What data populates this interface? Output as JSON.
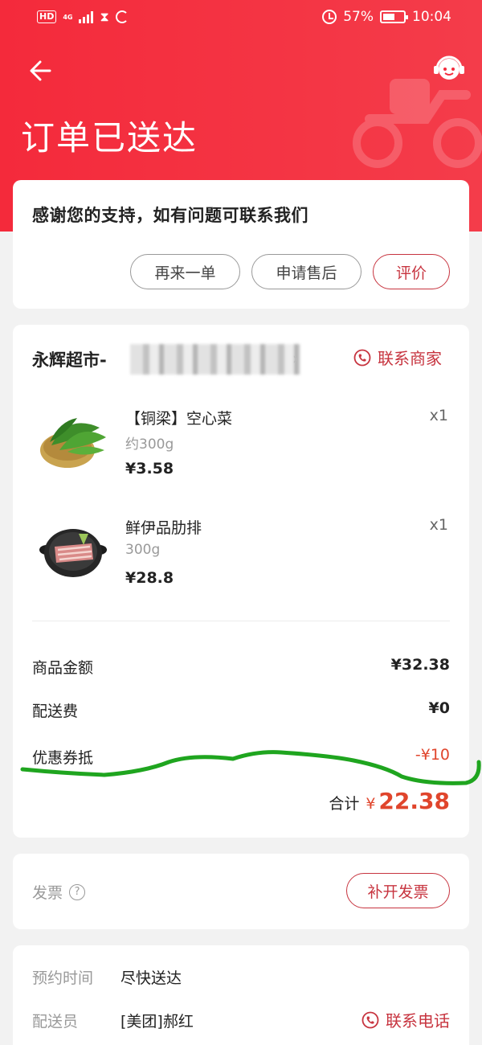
{
  "status_bar": {
    "hd": "HD",
    "network": "4G",
    "battery_percent": "57%",
    "time": "10:04"
  },
  "header": {
    "title": "订单已送达",
    "back_icon": "back-arrow-icon",
    "service_icon": "customer-service-icon"
  },
  "thanks_card": {
    "message": "感谢您的支持，如有问题可联系我们",
    "buttons": {
      "reorder": "再来一单",
      "after_sales": "申请售后",
      "review": "评价"
    }
  },
  "order": {
    "store_name": "永辉超市-",
    "contact_merchant": "联系商家",
    "products": [
      {
        "name": "【铜梁】空心菜",
        "spec": "约300g",
        "price": "¥3.58",
        "qty": "x1"
      },
      {
        "name": "鲜伊品肋排",
        "spec": "300g",
        "price": "¥28.8",
        "qty": "x1"
      }
    ],
    "fees": {
      "goods_label": "商品金额",
      "goods_value": "¥32.38",
      "delivery_label": "配送费",
      "delivery_value": "¥0",
      "coupon_label": "优惠券抵",
      "coupon_value": "-¥10"
    },
    "total_label": "合计",
    "total_currency": "¥",
    "total_amount": "22.38"
  },
  "invoice": {
    "label": "发票",
    "help_icon": "question-icon",
    "button": "补开发票"
  },
  "delivery": {
    "time_label": "预约时间",
    "time_value": "尽快送达",
    "courier_label": "配送员",
    "courier_value": "[美团]郝红",
    "contact_phone": "联系电话"
  },
  "colors": {
    "header_red": "#f42a3b",
    "accent_red": "#c7343f",
    "price_red": "#e0452c",
    "annotation_green": "#1fa51f"
  }
}
